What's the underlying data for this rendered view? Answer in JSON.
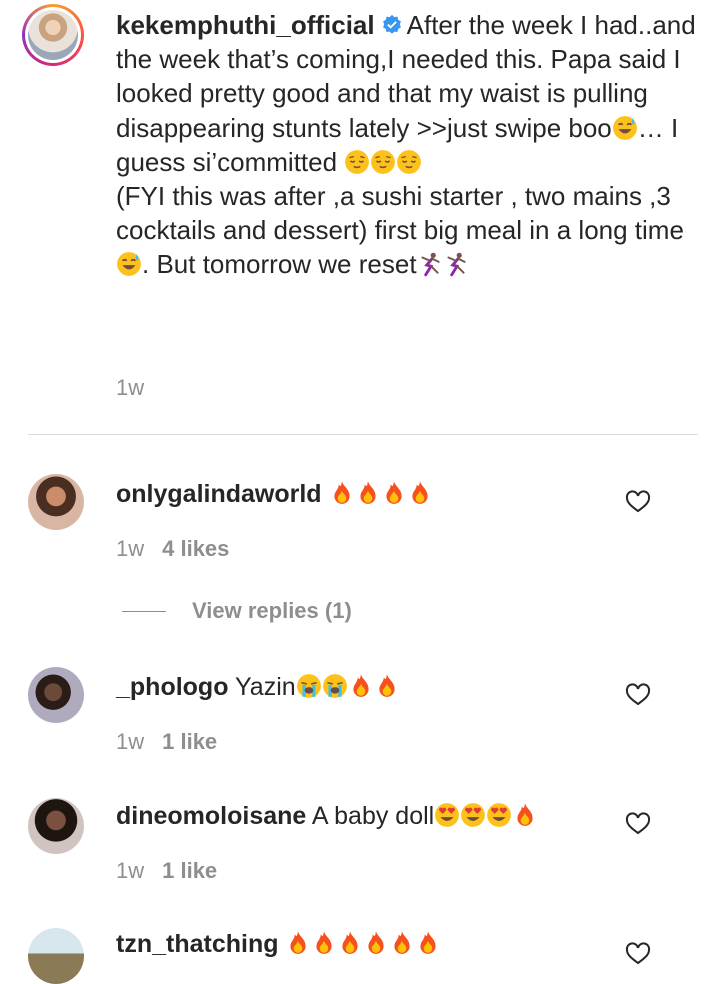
{
  "caption": {
    "username": "kekemphuthi_official",
    "line1": "After the week I had..and the week that’s coming,I needed this. Papa said I looked pretty good and that my waist is pulling disappearing stunts lately >>just swipe boo",
    "line1b": "… I guess si’committed",
    "line2": "(FYI this was after ,a sushi starter , two mains ,3 cocktails and dessert) first big meal in a long time",
    "line2b": ". But tomorrow we reset",
    "time": "1w"
  },
  "comments": [
    {
      "username": "onlygalindaworld",
      "text": "",
      "time": "1w",
      "likes": "4 likes",
      "replies_label": "View replies (1)"
    },
    {
      "username": "_phologo",
      "text": "Yazin",
      "time": "1w",
      "likes": "1 like"
    },
    {
      "username": "dineomoloisane",
      "text": "A baby doll",
      "time": "1w",
      "likes": "1 like"
    },
    {
      "username": "tzn_thatching",
      "text": "",
      "time": "",
      "likes": ""
    }
  ],
  "icons": {
    "verified": "verified-badge-icon",
    "heart": "heart-outline-icon",
    "fire": "fire-emoji",
    "sweat_smile": "sweat-smile-emoji",
    "relieved": "relieved-face-emoji",
    "sob": "loudly-crying-emoji",
    "heart_eyes": "heart-eyes-emoji",
    "dancer": "dancer-emoji"
  },
  "colors": {
    "text": "#262626",
    "secondary": "#8e8e8e",
    "verified": "#3897f0",
    "divider": "#dbdbdb"
  }
}
